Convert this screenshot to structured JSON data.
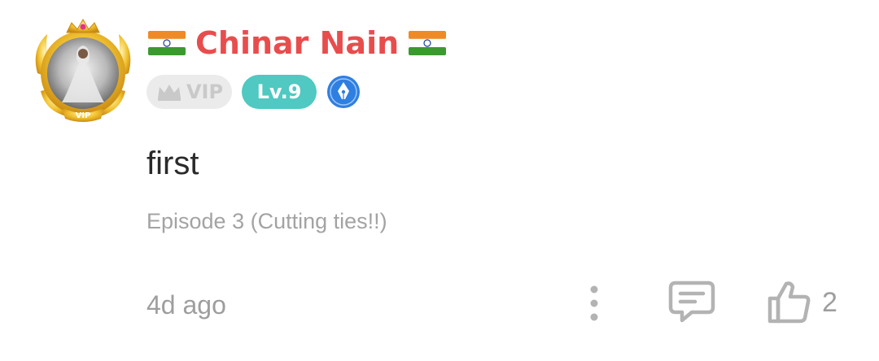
{
  "comment": {
    "username": "Chinar Nain",
    "flag_icon": "india-flag-icon",
    "badges": {
      "vip_label": "VIP",
      "level_label": "Lv.9",
      "writer_icon": "pen-nib-badge-icon"
    },
    "text": "first",
    "episode": "Episode 3 (Cutting ties!!)",
    "time_ago": "4d ago",
    "like_count": "2"
  },
  "colors": {
    "username": "#e84d4d",
    "level_badge": "#4fc9c1",
    "vip_badge_bg": "#ebebeb",
    "meta_text": "#9e9e9e",
    "avatar_frame_gold": "#f2c230",
    "writer_badge_blue": "#2f7fe0"
  },
  "icons": {
    "more": "more-vertical-icon",
    "reply": "comment-bubble-icon",
    "like": "thumbs-up-icon"
  }
}
